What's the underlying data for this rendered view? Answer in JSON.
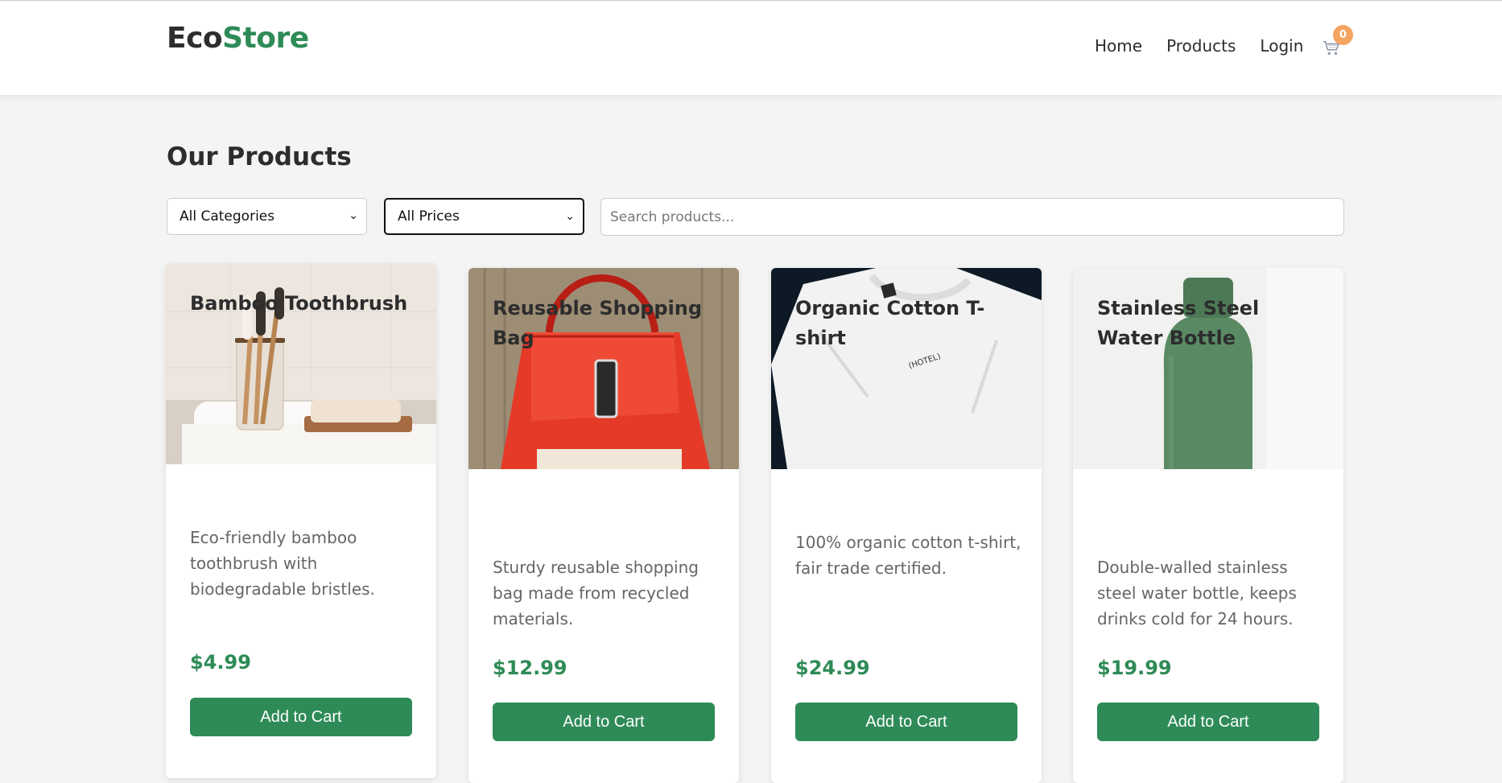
{
  "brand": {
    "part1": "Eco",
    "part2": "Store"
  },
  "nav": {
    "home": "Home",
    "products": "Products",
    "login": "Login"
  },
  "cart": {
    "count": "0"
  },
  "page_title": "Our Products",
  "filters": {
    "category": "All Categories",
    "price": "All Prices",
    "search_placeholder": "Search products..."
  },
  "products": [
    {
      "name": "Bamboo Toothbrush",
      "description": "Eco-friendly bamboo toothbrush with biodegradable bristles.",
      "price": "$4.99",
      "button": "Add to Cart"
    },
    {
      "name": "Reusable Shopping Bag",
      "description": "Sturdy reusable shopping bag made from recycled materials.",
      "price": "$12.99",
      "button": "Add to Cart"
    },
    {
      "name": "Organic Cotton T-shirt",
      "description": "100% organic cotton t-shirt, fair trade certified.",
      "price": "$24.99",
      "button": "Add to Cart"
    },
    {
      "name": "Stainless Steel Water Bottle",
      "description": "Double-walled stainless steel water bottle, keeps drinks cold for 24 hours.",
      "price": "$19.99",
      "button": "Add to Cart"
    }
  ],
  "colors": {
    "accent": "#2e8b57",
    "badge": "#f4a460"
  }
}
